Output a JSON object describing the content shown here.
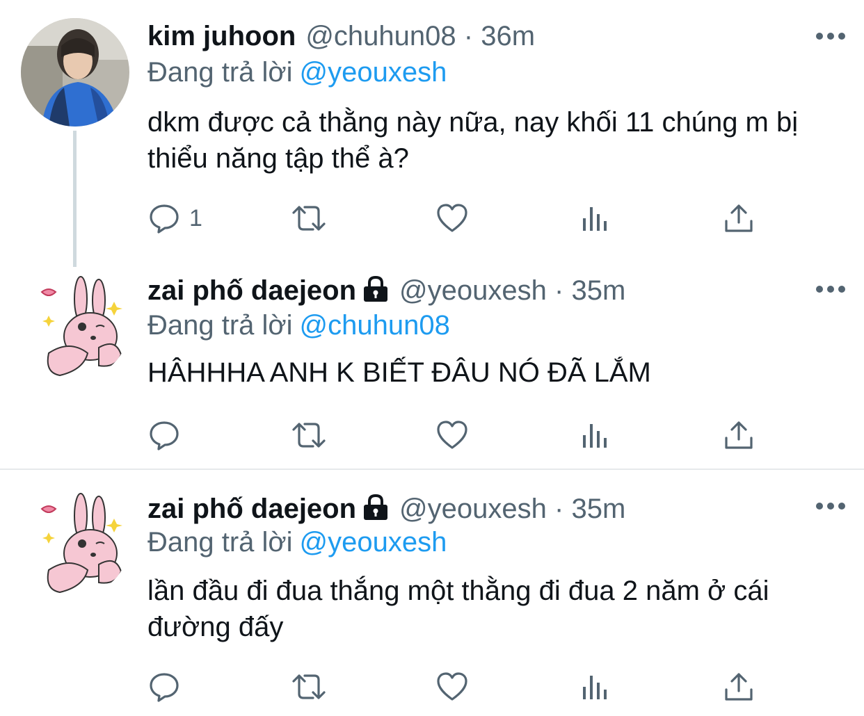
{
  "tweets": [
    {
      "name": "kim juhoon",
      "locked": false,
      "handle": "@chuhun08",
      "separator": "·",
      "time": "36m",
      "reply_prefix": "Đang trả lời",
      "reply_to": "@yeouxesh",
      "text": "dkm được cả thằng này nữa, nay khối 11 chúng m bị thiểu năng tập thể à?",
      "reply_count": "1",
      "avatar": "photo-avatar"
    },
    {
      "name": "zai phố daejeon",
      "locked": true,
      "handle": "@yeouxesh",
      "separator": "·",
      "time": "35m",
      "reply_prefix": "Đang trả lời",
      "reply_to": "@chuhun08",
      "text": "HÂHHHA ANH K BIẾT ĐÂU NÓ ĐÃ LẮM",
      "reply_count": "",
      "avatar": "rabbit-avatar"
    },
    {
      "name": "zai phố daejeon",
      "locked": true,
      "handle": "@yeouxesh",
      "separator": "·",
      "time": "35m",
      "reply_prefix": "Đang trả lời",
      "reply_to": "@yeouxesh",
      "text": "lần đầu đi đua thắng một thằng đi đua 2 năm ở cái đường đấy",
      "reply_count": "",
      "avatar": "rabbit-avatar"
    }
  ],
  "icons": {
    "reply": "reply-icon",
    "retweet": "retweet-icon",
    "like": "like-icon",
    "views": "views-icon",
    "share": "share-icon",
    "more": "more-icon",
    "lock": "lock-icon"
  },
  "colors": {
    "text": "#0f1419",
    "secondary": "#536471",
    "link": "#1d9bf0",
    "divider": "#e6e9eb",
    "thread_line": "#cfd9de"
  }
}
